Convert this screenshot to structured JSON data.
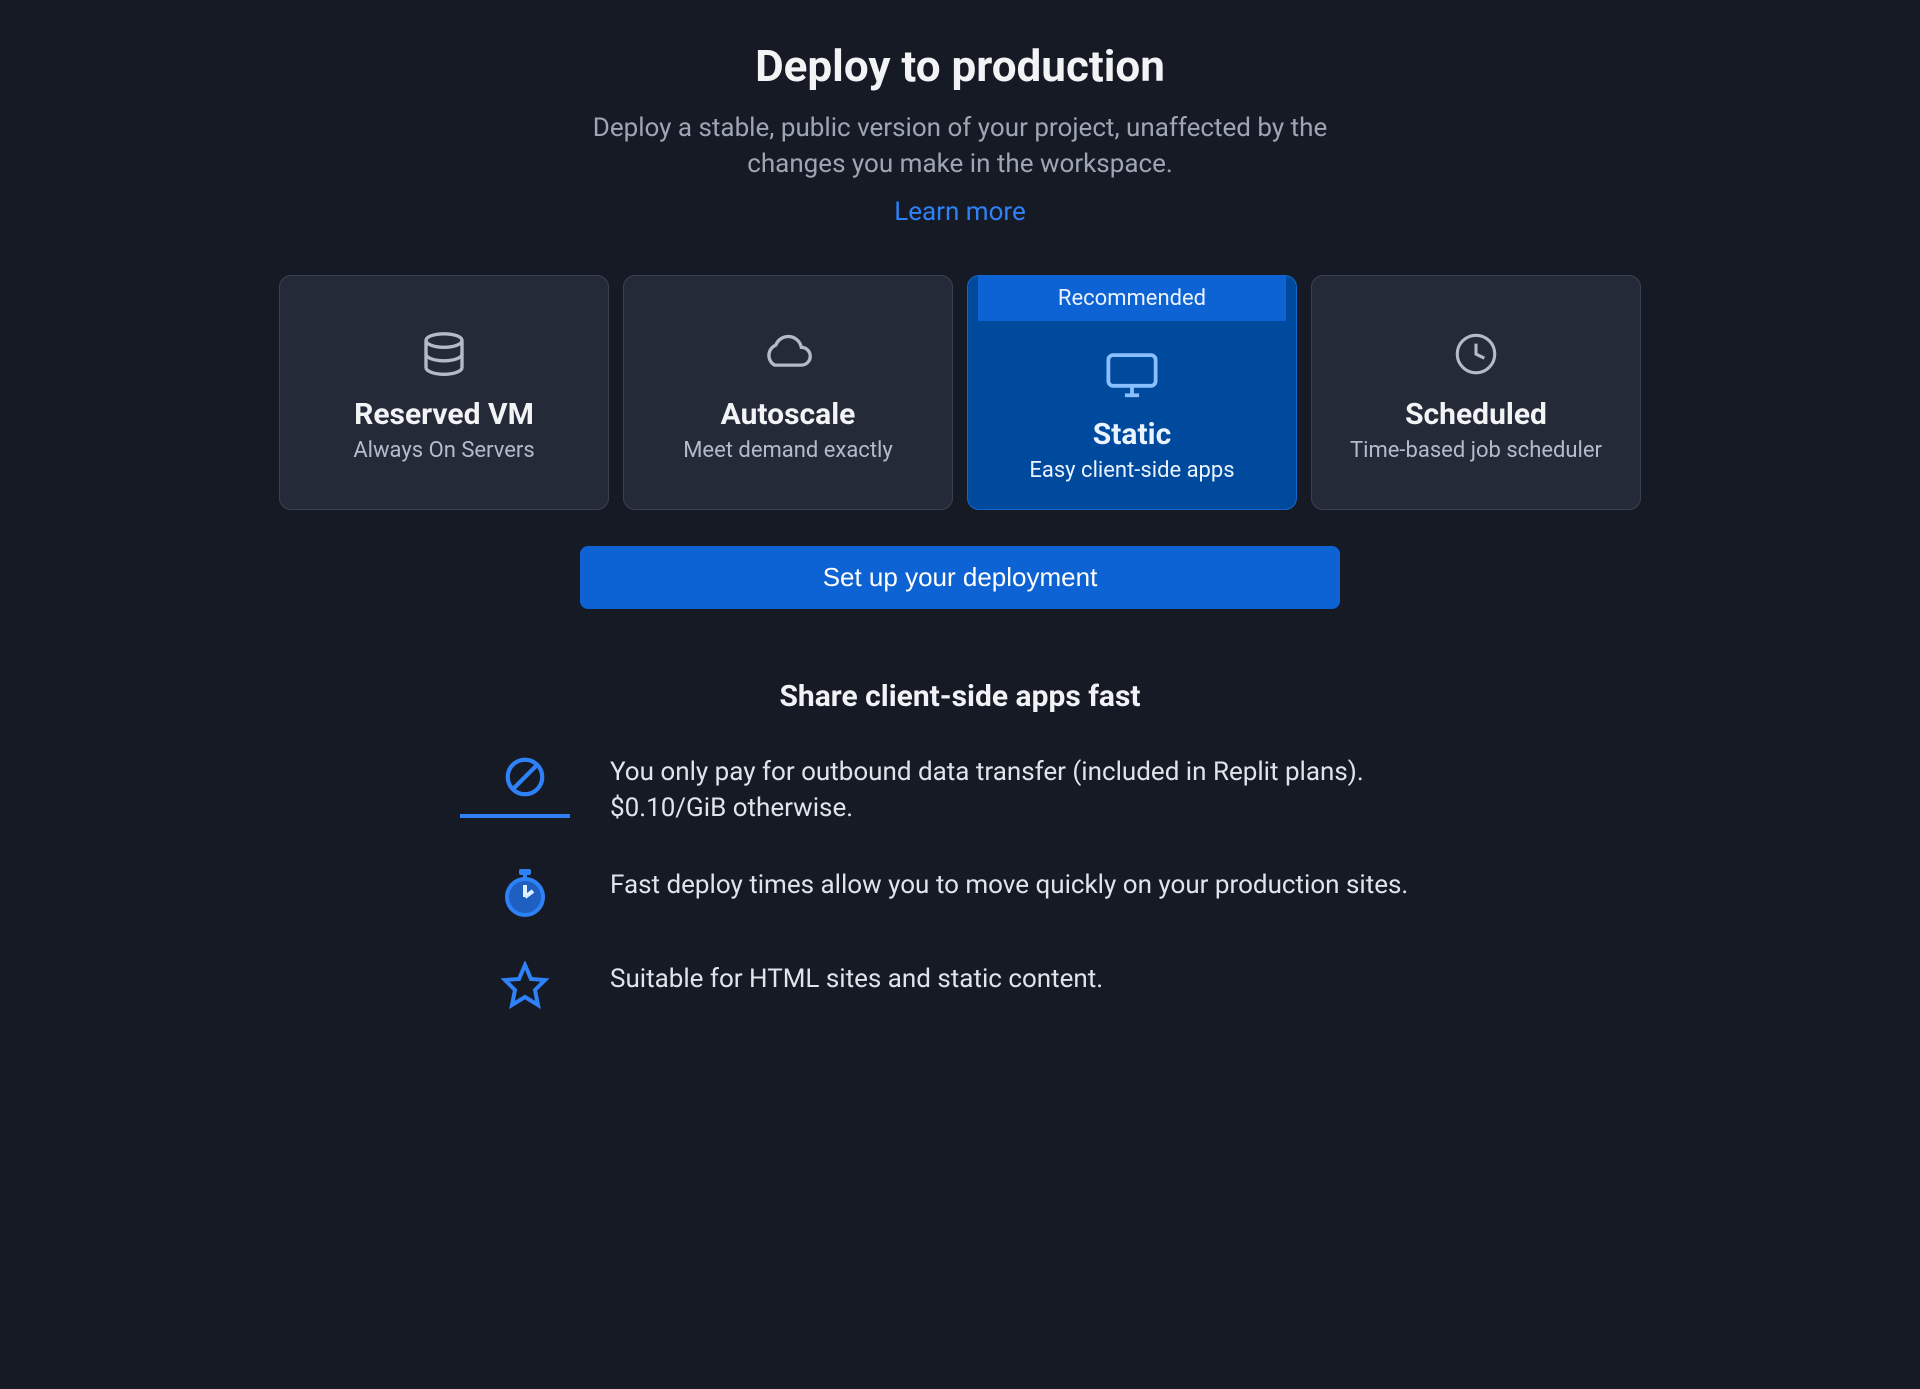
{
  "header": {
    "title": "Deploy to production",
    "subtitle": "Deploy a stable, public version of your project, unaffected by the changes you make in the workspace.",
    "learn_more": "Learn more"
  },
  "options": [
    {
      "title": "Reserved VM",
      "desc": "Always On Servers"
    },
    {
      "title": "Autoscale",
      "desc": "Meet demand exactly"
    },
    {
      "title": "Static",
      "desc": "Easy client-side apps",
      "badge": "Recommended",
      "selected": true
    },
    {
      "title": "Scheduled",
      "desc": "Time-based job scheduler"
    }
  ],
  "cta": {
    "label": "Set up your deployment"
  },
  "features": {
    "heading": "Share client-side apps fast",
    "items": [
      "You only pay for outbound data transfer (included in Replit plans). $0.10/GiB otherwise.",
      "Fast deploy times allow you to move quickly on your production sites.",
      "Suitable for HTML sites and static content."
    ]
  }
}
